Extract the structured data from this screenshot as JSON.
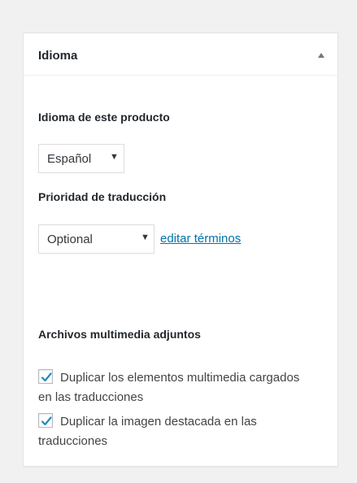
{
  "panel": {
    "title": "Idioma",
    "toggle_icon": "collapse-up-arrow-icon"
  },
  "language": {
    "label": "Idioma de este producto",
    "selected": "Español",
    "arrow": "▼"
  },
  "priority": {
    "label": "Prioridad de traducción",
    "selected": "Optional",
    "arrow": "▼",
    "edit_link": "editar términos"
  },
  "media": {
    "label": "Archivos multimedia adjuntos",
    "options": [
      {
        "label": "Duplicar los elementos multimedia cargados en las traducciones",
        "checked": true
      },
      {
        "label": "Duplicar la imagen destacada en las traducciones",
        "checked": true
      }
    ]
  },
  "colors": {
    "accent": "#0073aa",
    "check": "#1e8cbe"
  }
}
